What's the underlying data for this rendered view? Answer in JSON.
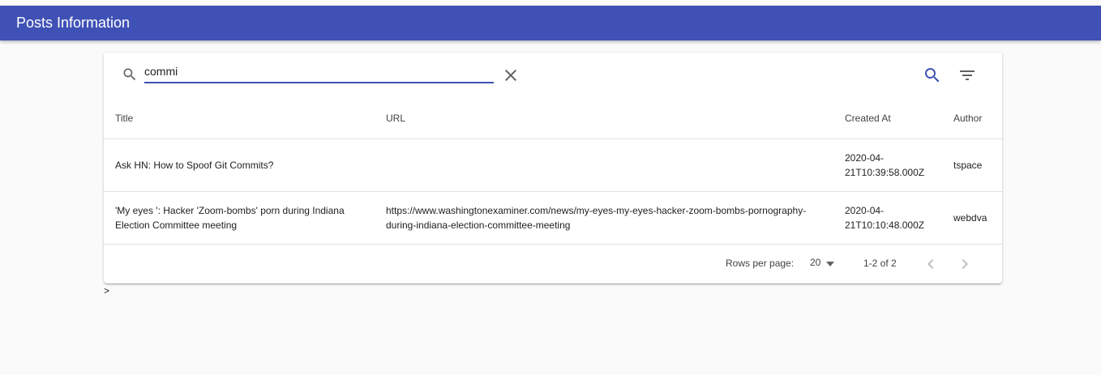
{
  "header": {
    "title": "Posts Information"
  },
  "search": {
    "value": "commi"
  },
  "icons": {
    "search": "search-icon",
    "clear": "close-icon",
    "search_button": "search-icon",
    "filter": "filter-list-icon",
    "dropdown": "arrow-drop-down-icon",
    "prev": "chevron-left-icon",
    "next": "chevron-right-icon"
  },
  "colors": {
    "appbar": "#3f51b5",
    "accent": "#3f51b5",
    "background": "#fafafa"
  },
  "table": {
    "columns": [
      "Title",
      "URL",
      "Created At",
      "Author"
    ],
    "rows": [
      {
        "title": "Ask HN: How to Spoof Git Commits?",
        "url": "",
        "created_at": "2020-04-21T10:39:58.000Z",
        "author": "tspace"
      },
      {
        "title": "'My eyes ': Hacker 'Zoom-bombs' porn during Indiana Election Committee meeting",
        "url": "https://www.washingtonexaminer.com/news/my-eyes-my-eyes-hacker-zoom-bombs-pornography-during-indiana-election-committee-meeting",
        "created_at": "2020-04-21T10:10:48.000Z",
        "author": "webdva"
      }
    ]
  },
  "pagination": {
    "rows_per_page_label": "Rows per page:",
    "rows_per_page_value": "20",
    "range": "1-2 of 2"
  },
  "stray_text": ">"
}
